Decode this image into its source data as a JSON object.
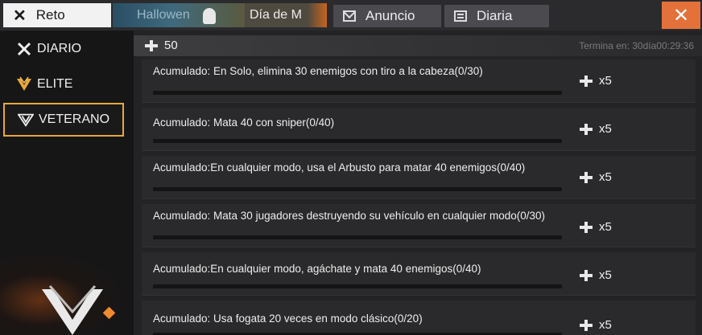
{
  "tabs": {
    "reto": "Reto",
    "event": "Hallowen",
    "dia": "Día de M",
    "anuncio": "Anuncio",
    "diaria": "Diaria"
  },
  "sidebar": {
    "items": [
      {
        "label": "DIARIO",
        "icon": "x-icon"
      },
      {
        "label": "ELITE",
        "icon": "elite-badge-icon"
      },
      {
        "label": "VETERANO",
        "icon": "veterano-badge-icon"
      }
    ],
    "active_index": 2
  },
  "points": "50",
  "countdown": "Termina en: 30día00:29:36",
  "tasks": [
    {
      "text": "Acumulado: En Solo, elimina 30 enemigos con tiro a la cabeza(0/30)",
      "reward": "x5",
      "progress": 0
    },
    {
      "text": "Acumulado: Mata 40 con sniper(0/40)",
      "reward": "x5",
      "progress": 0
    },
    {
      "text": "Acumulado:En cualquier modo, usa el Arbusto para matar 40 enemigos(0/40)",
      "reward": "x5",
      "progress": 0
    },
    {
      "text": "Acumulado: Mata 30 jugadores destruyendo su vehículo en cualquier modo(0/30)",
      "reward": "x5",
      "progress": 0
    },
    {
      "text": "Acumulado:En cualquier modo, agáchate y mata 40 enemigos(0/40)",
      "reward": "x5",
      "progress": 0
    },
    {
      "text": "Acumulado: Usa fogata 20 veces en modo clásico(0/20)",
      "reward": "x5",
      "progress": 0
    }
  ],
  "colors": {
    "accent": "#e6a93a",
    "close": "#e4713a"
  }
}
